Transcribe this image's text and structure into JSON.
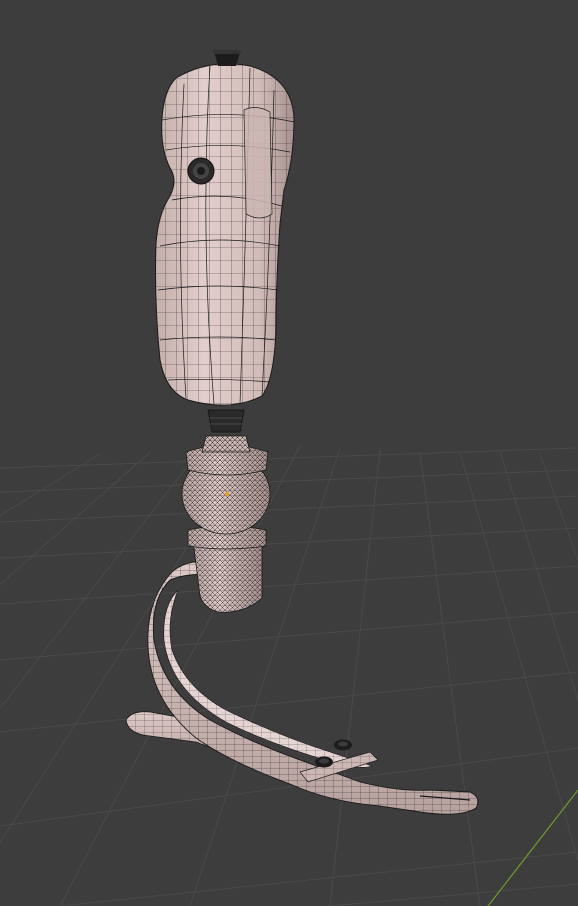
{
  "viewport": {
    "background": "#3d3d3d",
    "grid_color": "#4a4a4a",
    "y_axis_color": "#6f9a2e"
  },
  "model": {
    "surface_color": "#d7c1bf",
    "shade_color": "#b49a98",
    "wire_color": "#1a1a1a",
    "hardware_color": "#1c1c1c"
  },
  "icons": {
    "origin": "origin-dot-icon"
  }
}
